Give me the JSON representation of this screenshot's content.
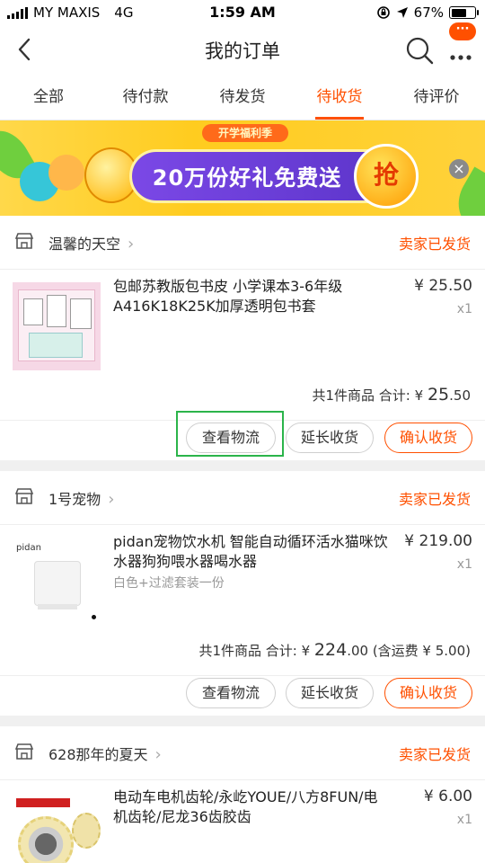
{
  "status_bar": {
    "carrier": "MY MAXIS",
    "network": "4G",
    "time": "1:59 AM",
    "battery_percent": "67%",
    "battery_level": 0.67
  },
  "nav": {
    "title": "我的订单",
    "badge": "···"
  },
  "tabs": [
    {
      "label": "全部",
      "active": false
    },
    {
      "label": "待付款",
      "active": false
    },
    {
      "label": "待发货",
      "active": false
    },
    {
      "label": "待收货",
      "active": true
    },
    {
      "label": "待评价",
      "active": false
    }
  ],
  "banner": {
    "tag": "开学福利季",
    "headline": "20万份好礼免费送",
    "grab": "抢",
    "close": "×"
  },
  "orders": [
    {
      "shop": "温馨的天空",
      "status": "卖家已发货",
      "product_title": "包邮苏教版包书皮 小学课本3-6年级A416K18K25K加厚透明包书套",
      "sku": "",
      "price": "¥ 25.50",
      "qty": "x1",
      "summary_prefix": "共1件商品 合计: ¥ ",
      "total_int": "25",
      "total_dec": ".50",
      "summary_suffix": "",
      "buttons": [
        "查看物流",
        "延长收货",
        "确认收货"
      ]
    },
    {
      "shop": "1号宠物",
      "status": "卖家已发货",
      "product_title": "pidan宠物饮水机 智能自动循环活水猫咪饮水器狗狗喂水器喝水器",
      "sku": "白色+过滤套装一份",
      "thumb_label": "pidan",
      "price": "¥ 219.00",
      "qty": "x1",
      "summary_prefix": "共1件商品 合计: ¥ ",
      "total_int": "224",
      "total_dec": ".00",
      "summary_suffix": " (含运费 ¥ 5.00)",
      "buttons": [
        "查看物流",
        "延长收货",
        "确认收货"
      ]
    },
    {
      "shop": "628那年的夏天",
      "status": "卖家已发货",
      "product_title": "电动车电机齿轮/永屹YOUE/八方8FUN/电机齿轮/尼龙36齿胶齿",
      "sku": "",
      "price": "¥ 6.00",
      "qty": "x1"
    }
  ],
  "colors": {
    "accent": "#ff5000",
    "highlight": "#2bb44a"
  }
}
